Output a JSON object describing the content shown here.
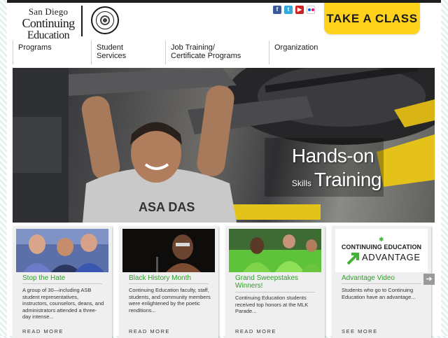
{
  "header": {
    "logo": {
      "line1": "San Diego",
      "line2": "Continuing",
      "line3": "Education"
    },
    "seal_icon": "college-seal-icon",
    "social": [
      {
        "name": "facebook-icon",
        "glyph": "f"
      },
      {
        "name": "twitter-icon",
        "glyph": "t"
      },
      {
        "name": "youtube-icon",
        "glyph": "▶"
      },
      {
        "name": "flickr-icon",
        "glyph": ""
      }
    ],
    "cta_label": "TAKE A CLASS"
  },
  "nav": {
    "items": [
      {
        "label": "Programs"
      },
      {
        "label": "Student\nServices"
      },
      {
        "label": "Job Training/\nCertificate Programs"
      },
      {
        "label": "Organization"
      }
    ]
  },
  "hero": {
    "line1": "Hands-on",
    "skills": "Skills",
    "training": "Training"
  },
  "cards": [
    {
      "title": "Stop the Hate",
      "body": "A group of 30—including ASB student representatives, instructors, counselors, deans, and administrators attended a three-day intense...",
      "more": "READ MORE"
    },
    {
      "title": "Black History Month",
      "body": "Continuing Education faculty, staff, students, and community members were enlightened by the poetic renditions...",
      "more": "READ MORE"
    },
    {
      "title": "Grand Sweepstakes Winners!",
      "body": "Continuing Education students received top honors at the MLK Parade...",
      "more": "READ MORE"
    },
    {
      "title": "Advantage Video",
      "body": "Students who go to Continuing Education have an advantage...",
      "more": "SEE MORE",
      "logo_top": "CONTINUING EDUCATION",
      "logo_bottom": "ADVANTAGE"
    }
  ],
  "carousel": {
    "next_glyph": "➔"
  },
  "colors": {
    "accent_yellow": "#ffd21c",
    "card_title_green": "#2f9e2a",
    "facebook_blue": "#3b5998",
    "twitter_blue": "#33aadd",
    "youtube_red": "#cc2222"
  }
}
